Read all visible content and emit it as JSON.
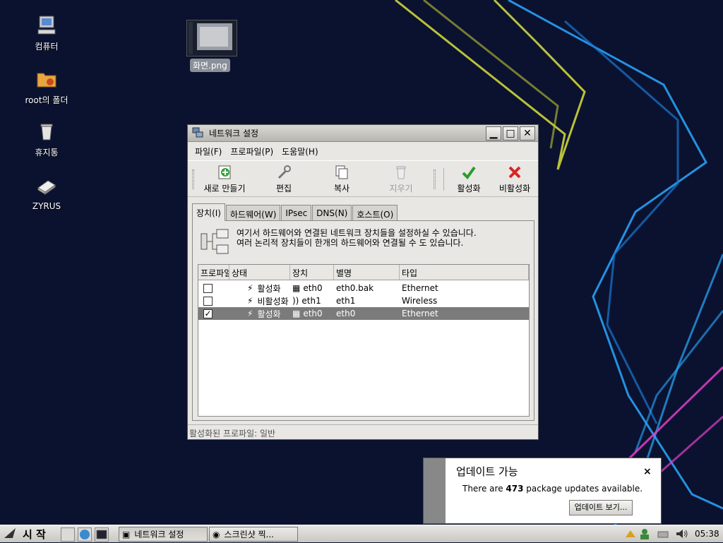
{
  "desktop": {
    "icons": [
      {
        "label": "컴퓨터"
      },
      {
        "label": "root의 폴더"
      },
      {
        "label": "휴지통"
      },
      {
        "label": "ZYRUS"
      }
    ],
    "file": {
      "label": "화면.png"
    }
  },
  "window": {
    "title": "네트워크 설정",
    "menu": [
      "파일(F)",
      "프로파일(P)",
      "도움말(H)"
    ],
    "toolbar": {
      "new_label": "새로 만들기",
      "edit_label": "편집",
      "copy_label": "복사",
      "delete_label": "지우기",
      "activate_label": "활성화",
      "deactivate_label": "비활성화"
    },
    "tabs": [
      "장치(I)",
      "하드웨어(W)",
      "IPsec",
      "DNS(N)",
      "호스트(O)"
    ],
    "description": "여기서 하드웨어와 연결된 네트워크 장치들을 설정하실 수 있습니다. 여러 논리적 장치들이 한개의 하드웨어와 연결될 수 도 있습니다.",
    "columns": [
      "프로파일",
      "상태",
      "장치",
      "별명",
      "타입"
    ],
    "rows": [
      {
        "checked": "",
        "status": "활성화",
        "device": "eth0",
        "nickname": "eth0.bak",
        "type": "Ethernet"
      },
      {
        "checked": "",
        "status": "비활성화",
        "device": "eth1",
        "nickname": "eth1",
        "type": "Wireless"
      },
      {
        "checked": "✓",
        "status": "활성화",
        "device": "eth0",
        "nickname": "eth0",
        "type": "Ethernet"
      }
    ],
    "statusbar": "활성화된 프로파일: 일반"
  },
  "notification": {
    "title": "업데이트 가능",
    "body_pre": "There are ",
    "count": "473",
    "body_post": " package updates available.",
    "button": "업데이트 보기...",
    "close": "×"
  },
  "taskbar": {
    "start_label": "시 작",
    "tasks": [
      "네트워크 설정",
      "스크린샷 찍..."
    ],
    "clock": "05:38"
  },
  "colors": {
    "desktop_bg": "#0b1230",
    "selection": "#7b7b7b",
    "neon_yellow": "#d8e23a",
    "neon_blue": "#2aa8ff",
    "neon_pink": "#e040c8"
  }
}
